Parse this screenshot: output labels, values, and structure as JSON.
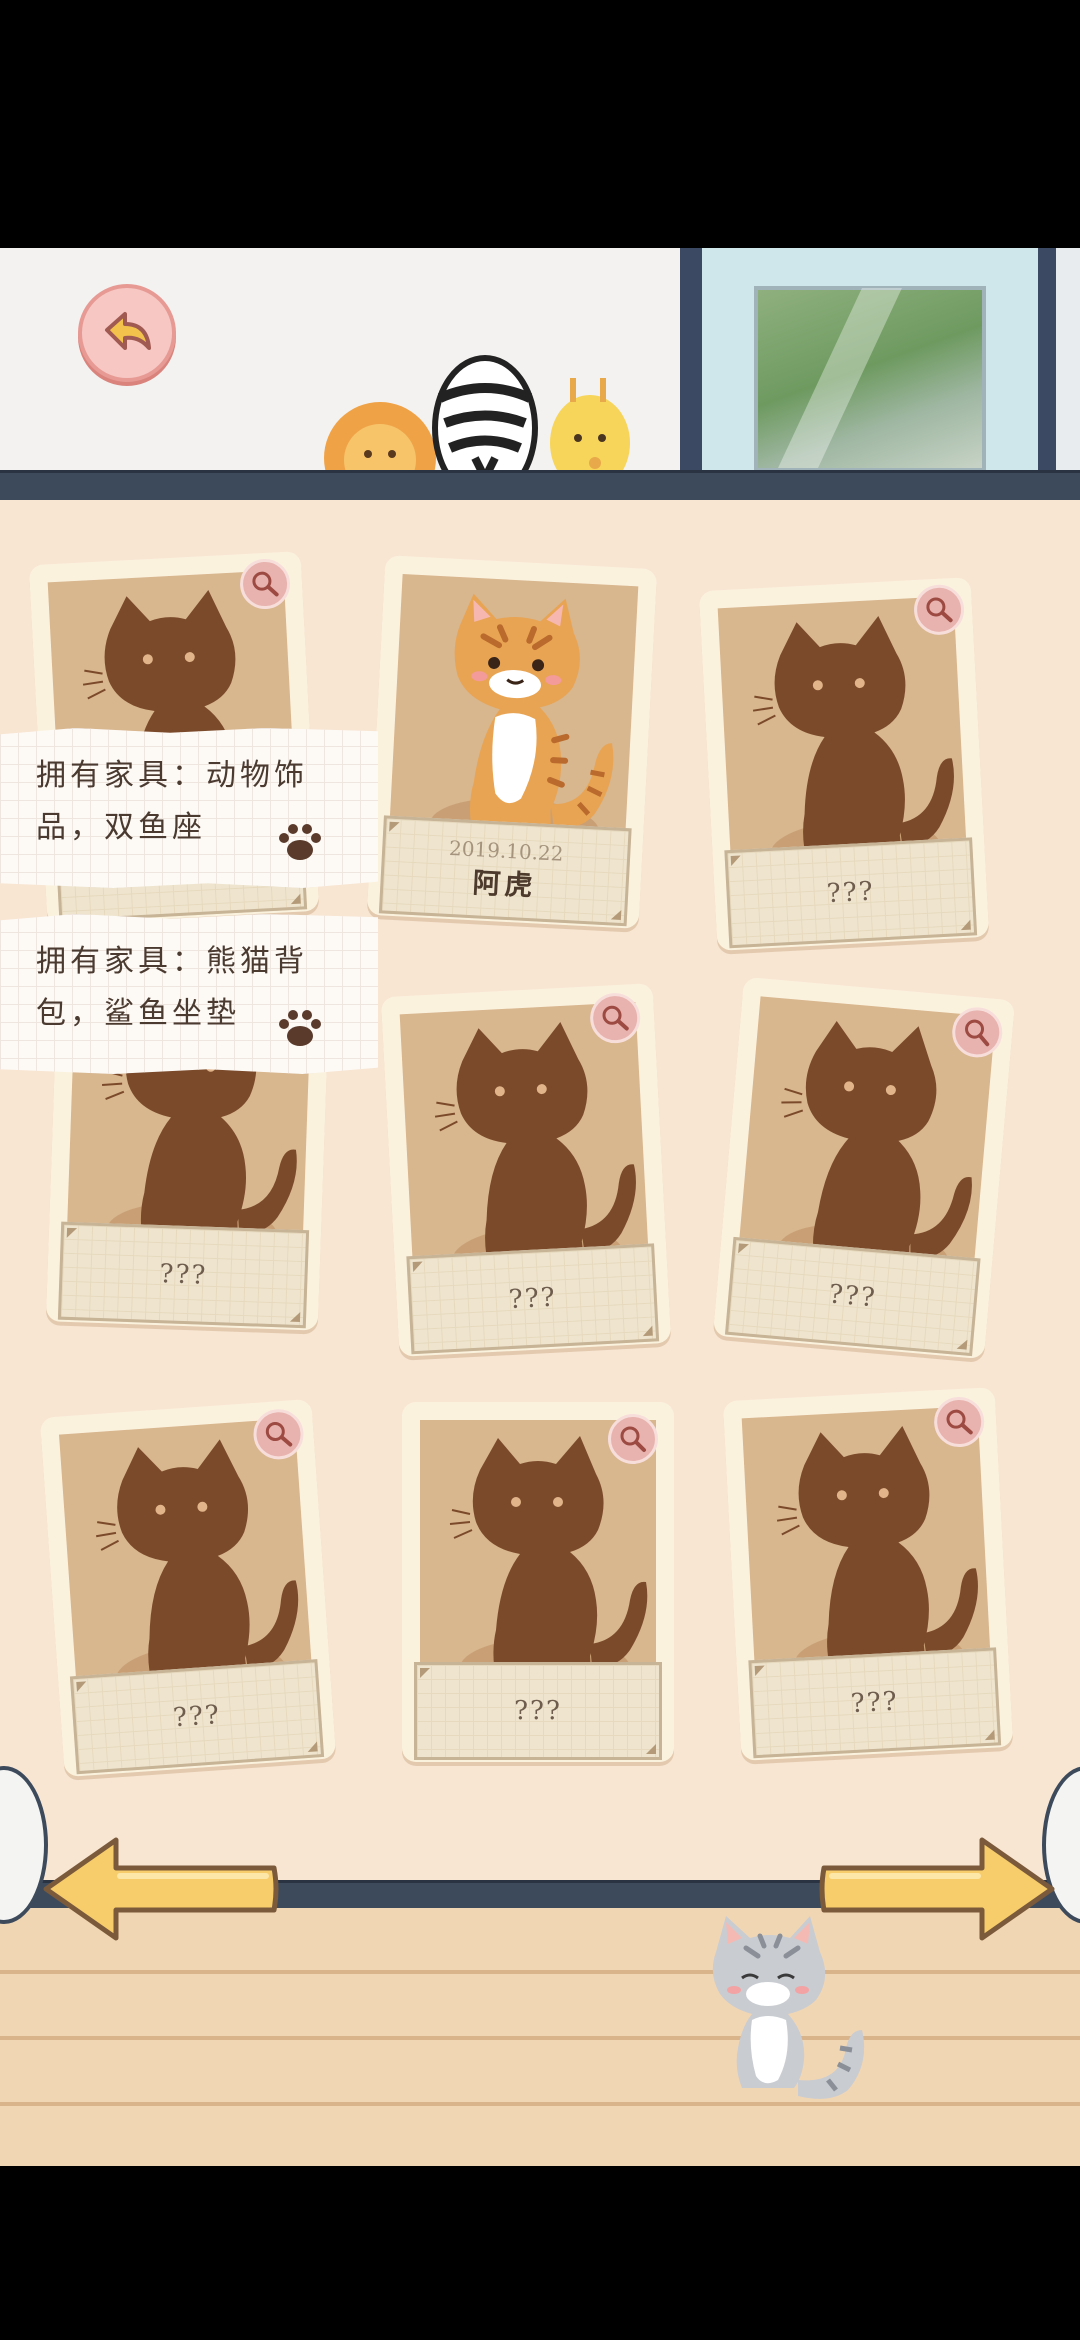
{
  "header": {
    "back_button": "back"
  },
  "notes": [
    {
      "text": "拥有家具：动物饰品，双鱼座"
    },
    {
      "text": "拥有家具：熊猫背包，鲨鱼坐垫"
    }
  ],
  "cards": [
    {
      "label": "???",
      "locked": true
    },
    {
      "date": "2019.10.22",
      "label": "阿虎",
      "locked": false
    },
    {
      "label": "???",
      "locked": true
    },
    {
      "label": "???",
      "locked": true
    },
    {
      "label": "???",
      "locked": true
    },
    {
      "label": "???",
      "locked": true
    },
    {
      "label": "???",
      "locked": true
    },
    {
      "label": "???",
      "locked": true
    },
    {
      "label": "???",
      "locked": true
    }
  ],
  "navigation": {
    "prev": "previous-page",
    "next": "next-page"
  },
  "colors": {
    "silhouette": "#7b4a2a",
    "panel": "#f8e6d3",
    "band": "#3c4a5c",
    "accent_pink": "#e8b3ae",
    "arrow": "#f7cc6b"
  }
}
